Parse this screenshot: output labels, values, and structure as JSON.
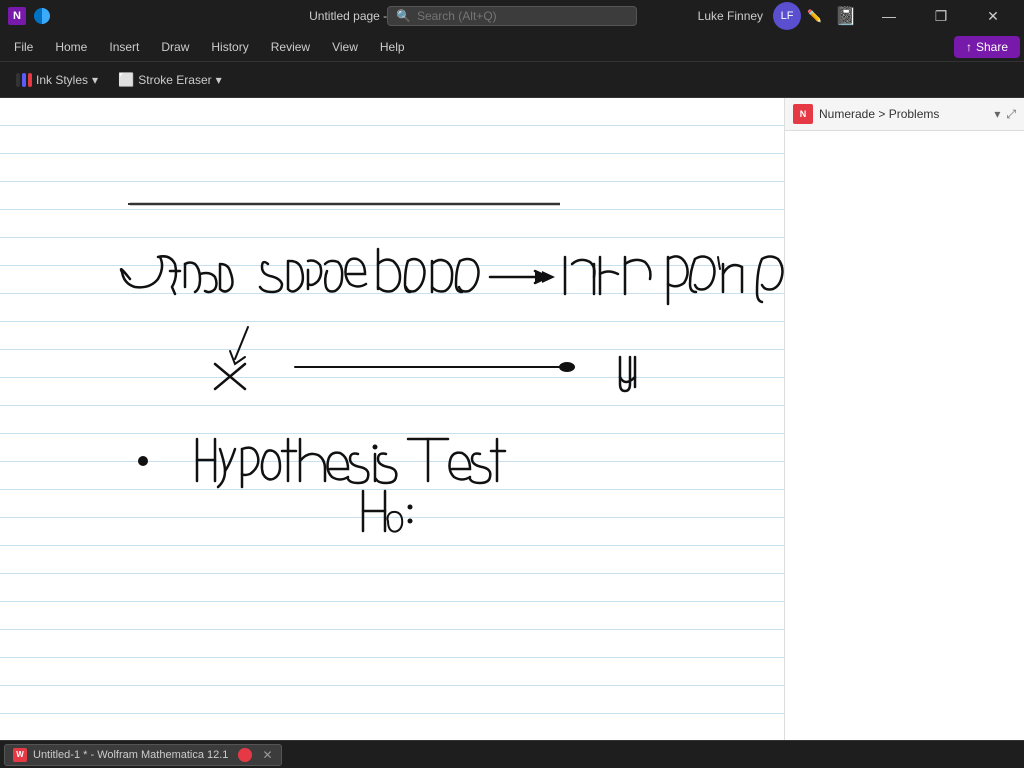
{
  "titlebar": {
    "app_name": "N",
    "title": "Untitled page - OneNote",
    "search_placeholder": "Search (Alt+Q)",
    "user_name": "Luke Finney",
    "window_controls": {
      "minimize": "—",
      "maximize": "❐",
      "close": "✕"
    }
  },
  "menubar": {
    "items": [
      "File",
      "Home",
      "Insert",
      "Draw",
      "History",
      "Review",
      "View",
      "Help"
    ]
  },
  "toolbar": {
    "ink_styles_label": "Ink Styles",
    "stroke_eraser_label": "Stroke Eraser",
    "chevron": "▾"
  },
  "side_panel": {
    "numerade_text": "N",
    "title": "Numerade > Problems",
    "chevron": "▾",
    "expand": "⤢"
  },
  "taskbar": {
    "item_label": "Untitled-1 * - Wolfram Mathematica 12.1",
    "close": "✕"
  },
  "share_button": "Share"
}
